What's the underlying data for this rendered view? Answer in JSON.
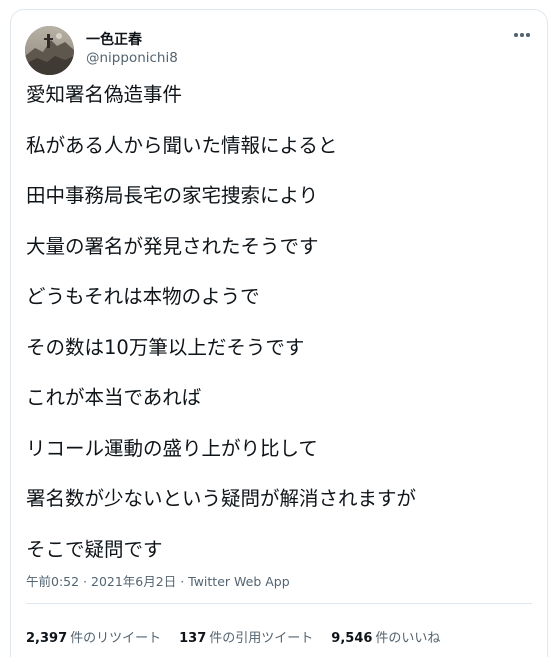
{
  "author": {
    "display_name": "一色正春",
    "handle": "@nipponichi8",
    "avatar_icon": "profile-photo"
  },
  "menu_icon": "more-dots-icon",
  "tweet_lines": [
    "愛知署名偽造事件",
    "私がある人から聞いた情報によると",
    "田中事務局長宅の家宅捜索により",
    "大量の署名が発見されたそうです",
    "どうもそれは本物のようで",
    "その数は10万筆以上だそうです",
    "これが本当であれば",
    "リコール運動の盛り上がり比して",
    "署名数が少ないという疑問が解消されますが",
    "そこで疑問です"
  ],
  "meta": {
    "time": "午前0:52",
    "separator": " · ",
    "date": "2021年6月2日",
    "source": "Twitter Web App"
  },
  "stats": {
    "retweets_count": "2,397",
    "retweets_label": "件のリツイート",
    "quotes_count": "137",
    "quotes_label": "件の引用ツイート",
    "likes_count": "9,546",
    "likes_label": "件のいいね"
  },
  "colors": {
    "text": "#0f1419",
    "secondary": "#536471",
    "border": "#e1e8ed"
  }
}
